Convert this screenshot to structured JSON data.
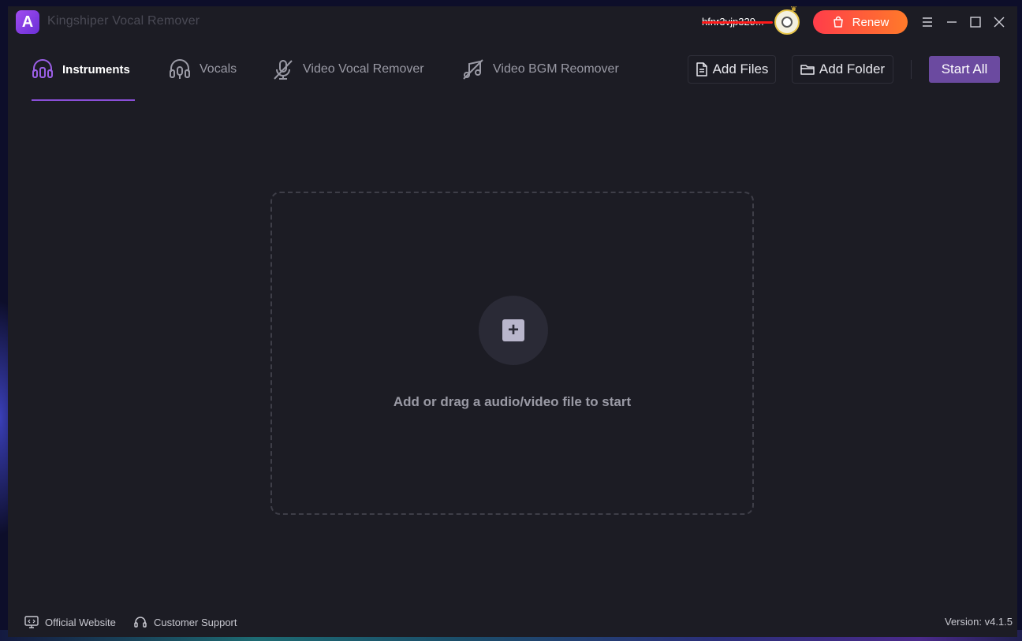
{
  "app": {
    "title": "Kingshiper Vocal Remover",
    "logo_letter": "A"
  },
  "account": {
    "username": "hfnr3vjp329...",
    "renew_label": "Renew",
    "renew_color": "#ff5a3a"
  },
  "tabs": [
    {
      "label": "Instruments",
      "icon": "headphones-icon",
      "active": true
    },
    {
      "label": "Vocals",
      "icon": "headset-mic-icon",
      "active": false
    },
    {
      "label": "Video Vocal Remover",
      "icon": "mic-off-icon",
      "active": false
    },
    {
      "label": "Video BGM Reomover",
      "icon": "music-off-icon",
      "active": false
    }
  ],
  "toolbar": {
    "add_files_label": "Add Files",
    "add_folder_label": "Add Folder",
    "start_all_label": "Start All"
  },
  "dropzone": {
    "text": "Add or drag a audio/video file to start",
    "icon": "plus-icon"
  },
  "footer": {
    "official_website": "Official Website",
    "customer_support": "Customer Support",
    "version": "Version: v4.1.5"
  },
  "colors": {
    "accent": "#8a4fd8",
    "start_button": "#6b4aa0",
    "background": "#1c1c24"
  }
}
